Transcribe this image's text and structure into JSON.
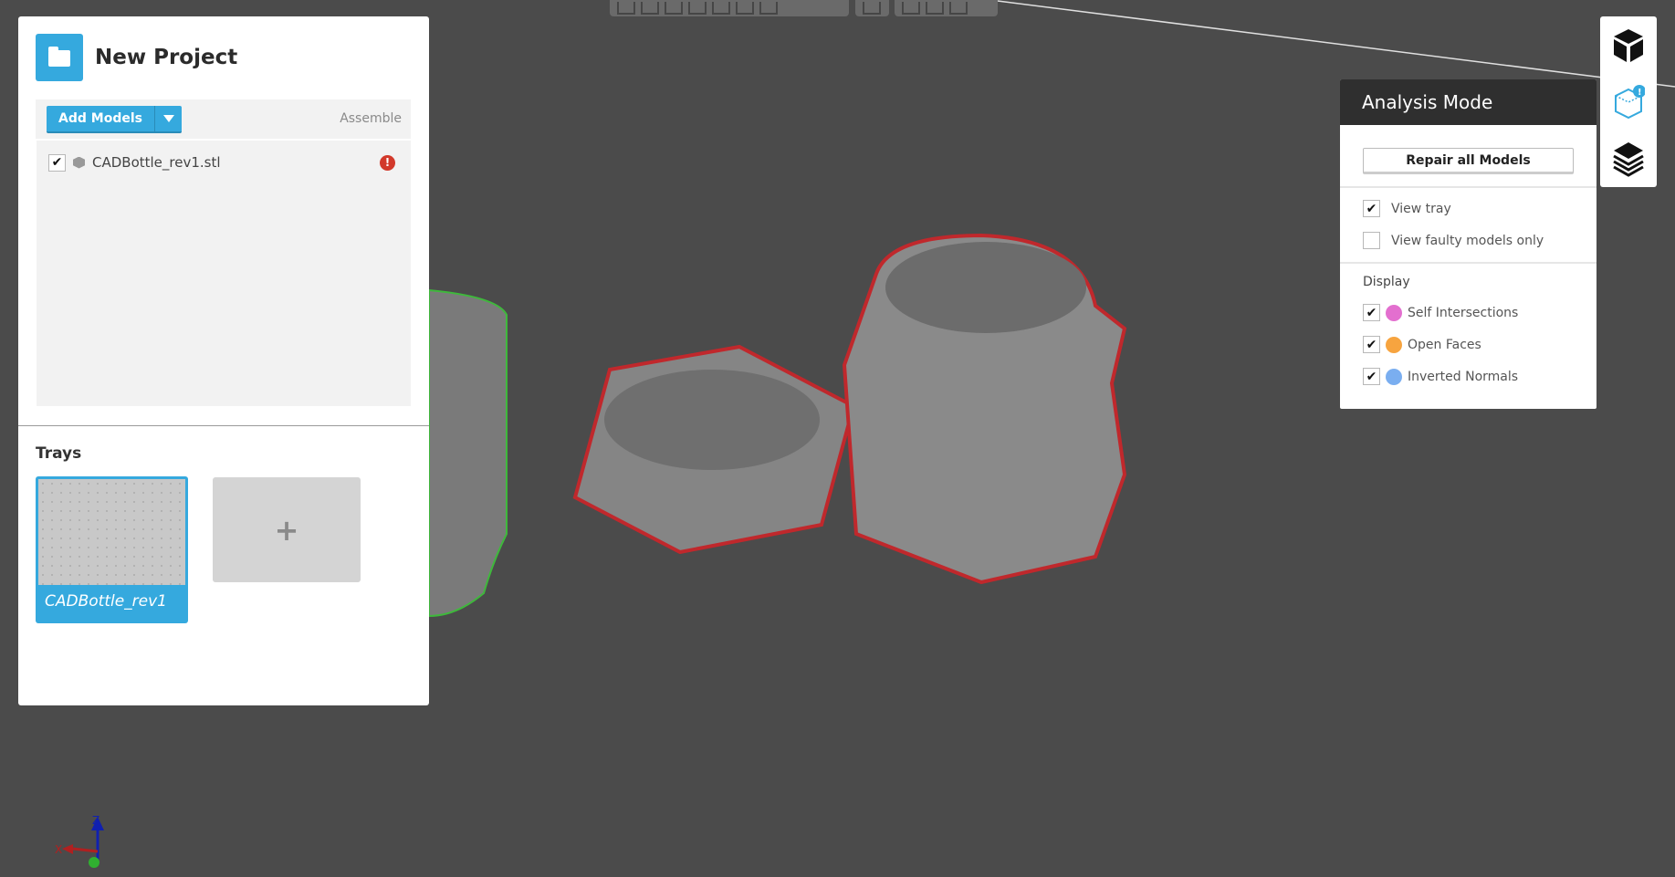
{
  "viewport": {
    "toolbar_icons": [
      "view-front-icon",
      "view-back-icon",
      "view-left-icon",
      "view-right-icon",
      "view-top-icon",
      "view-bottom-icon",
      "view-iso-icon",
      "perspective-icon",
      "zoom-fit-icon",
      "zoom-selection-icon",
      "zoom-plane-icon"
    ],
    "axes": {
      "x": "X",
      "z": "Z"
    }
  },
  "project": {
    "title": "New Project",
    "add_models": "Add Models",
    "assemble": "Assemble",
    "models": [
      {
        "name": "CADBottle_rev1.stl",
        "checked": true,
        "status": "error"
      }
    ],
    "trays_label": "Trays",
    "trays": [
      {
        "name": "CADBottle_rev1",
        "selected": true
      }
    ],
    "add_tray": "+"
  },
  "analysis": {
    "title": "Analysis Mode",
    "repair_button": "Repair all Models",
    "options": [
      {
        "label": "View tray",
        "checked": true
      },
      {
        "label": "View faulty models only",
        "checked": false
      }
    ],
    "display_label": "Display",
    "display": [
      {
        "label": "Self Intersections",
        "checked": true,
        "color": "#e36fcf"
      },
      {
        "label": "Open Faces",
        "checked": true,
        "color": "#f7a43f"
      },
      {
        "label": "Inverted Normals",
        "checked": true,
        "color": "#7aaef0"
      }
    ]
  },
  "right_toolbar": [
    "cube-solid-icon",
    "analysis-cube-icon",
    "layers-icon"
  ],
  "colors": {
    "accent": "#35a9de",
    "error": "#d2392b",
    "faulty_outline": "#c0282c",
    "ok_outline": "#3fb83c"
  }
}
